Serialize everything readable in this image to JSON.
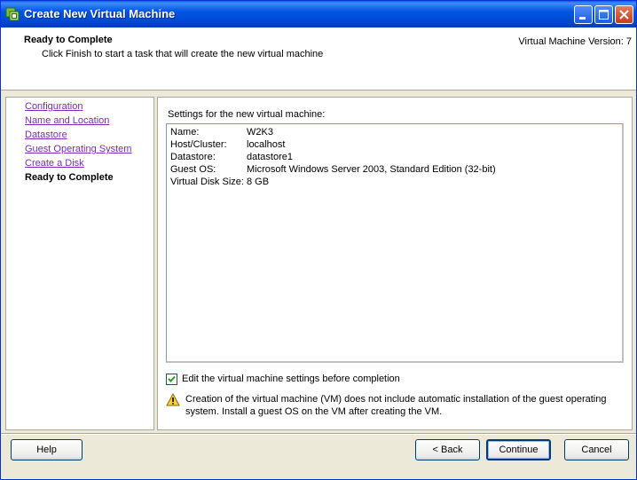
{
  "window": {
    "title": "Create New Virtual Machine"
  },
  "header": {
    "title": "Ready to Complete",
    "subtitle": "Click Finish to start a task that will create the new virtual machine",
    "version": "Virtual Machine Version: 7"
  },
  "sidebar": {
    "items": [
      {
        "label": "Configuration"
      },
      {
        "label": "Name and Location"
      },
      {
        "label": "Datastore"
      },
      {
        "label": "Guest Operating System"
      },
      {
        "label": "Create a Disk"
      },
      {
        "label": "Ready to Complete"
      }
    ]
  },
  "main": {
    "settings_label": "Settings for the new virtual machine:",
    "settings": [
      {
        "key": "Name:",
        "value": "W2K3"
      },
      {
        "key": "Host/Cluster:",
        "value": "localhost"
      },
      {
        "key": "Datastore:",
        "value": "datastore1"
      },
      {
        "key": "Guest OS:",
        "value": "Microsoft Windows Server 2003, Standard Edition (32-bit)"
      },
      {
        "key": "Virtual Disk Size:",
        "value": "8 GB"
      }
    ],
    "edit_checkbox": {
      "label": "Edit the virtual machine settings before completion",
      "checked": true
    },
    "warning": "Creation of the virtual machine (VM) does not include automatic installation of the guest operating system. Install a guest OS on the VM after creating the VM."
  },
  "footer": {
    "help": "Help",
    "back": "< Back",
    "continue": "Continue",
    "cancel": "Cancel"
  },
  "icons": {
    "app": "vm-icon",
    "minimize": "minimize-icon",
    "maximize": "maximize-icon",
    "close": "close-icon",
    "warning": "warning-icon",
    "check": "checkmark-icon"
  },
  "colors": {
    "titlebar": "#0055e5",
    "visited_link": "#7b2bbd",
    "window_bg": "#ece9d8"
  }
}
